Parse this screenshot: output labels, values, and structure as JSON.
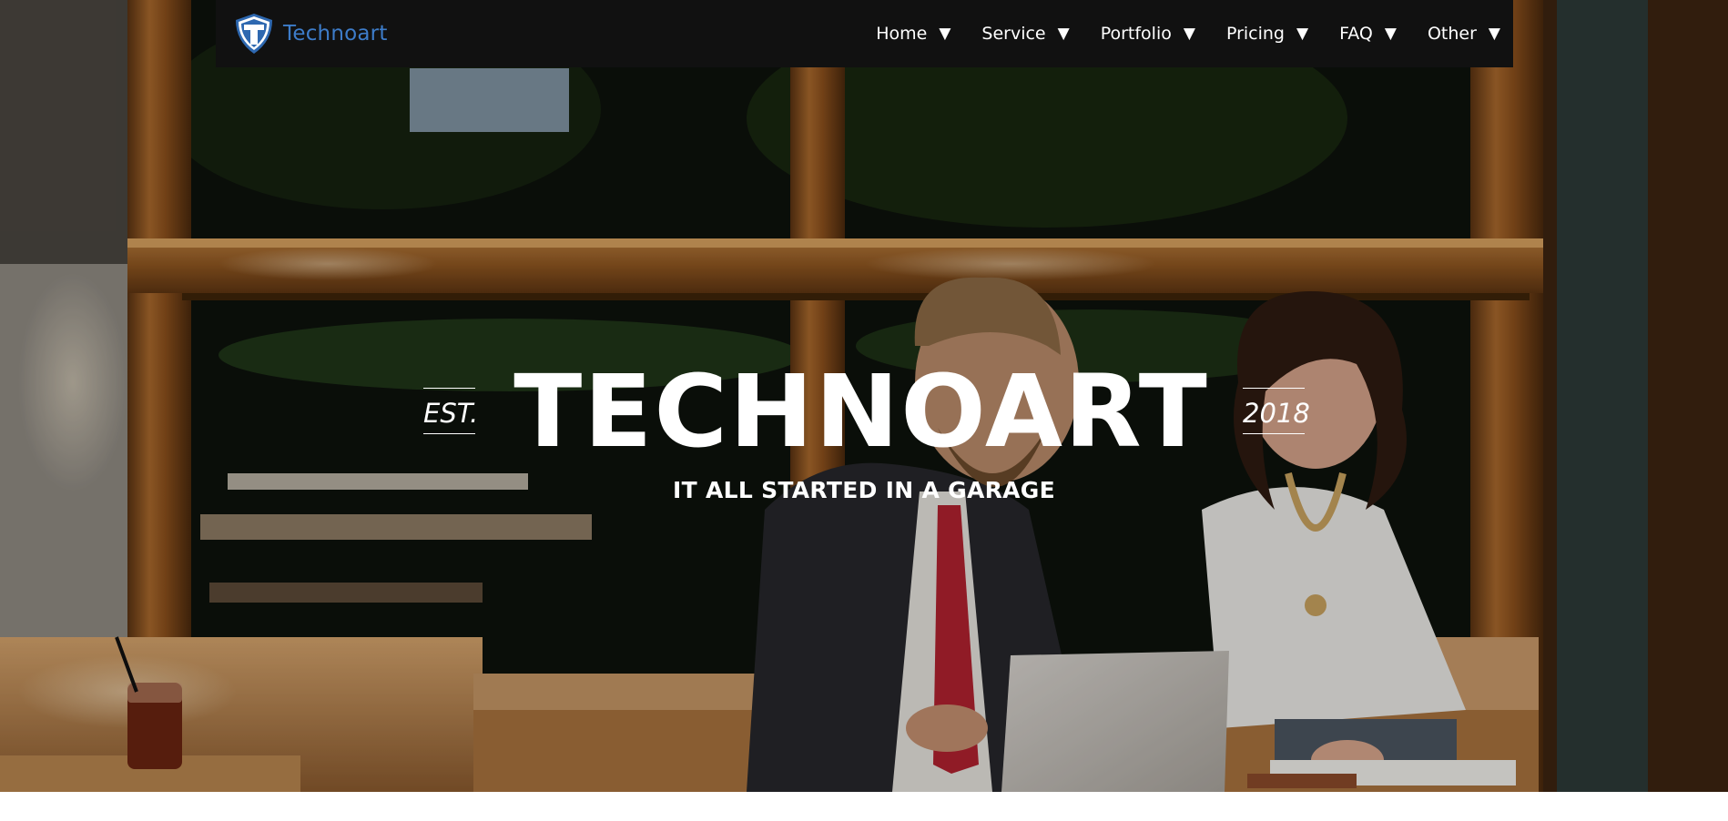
{
  "navbar": {
    "brand": {
      "name": "Technoart",
      "logo_icon": "shield-t-logo-icon",
      "color": "#3d7cc9"
    },
    "items": [
      {
        "label": "Home",
        "icon": "caret-down-icon",
        "caret": "▼"
      },
      {
        "label": "Service",
        "icon": "caret-down-icon",
        "caret": "▼"
      },
      {
        "label": "Portfolio",
        "icon": "caret-down-icon",
        "caret": "▼"
      },
      {
        "label": "Pricing",
        "icon": "caret-down-icon",
        "caret": "▼"
      },
      {
        "label": "FAQ",
        "icon": "caret-down-icon",
        "caret": "▼"
      },
      {
        "label": "Other",
        "icon": "caret-down-icon",
        "caret": "▼"
      }
    ],
    "background": "#111111"
  },
  "hero": {
    "est_label": "EST.",
    "title": "TECHNOART",
    "year": "2018",
    "tagline": "IT ALL STARTED IN A GARAGE"
  }
}
